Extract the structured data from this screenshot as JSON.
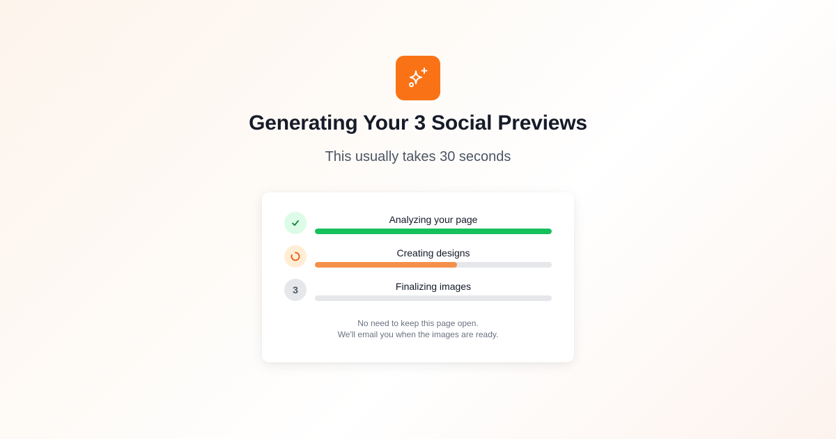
{
  "header": {
    "icon": "sparkles-icon",
    "accent_color": "#f97316",
    "title": "Generating Your 3 Social Previews",
    "subtitle": "This usually takes 30 seconds"
  },
  "steps": [
    {
      "label": "Analyzing your page",
      "status": "complete",
      "badge": "✓",
      "progress": 1.0,
      "color": "#16c05a"
    },
    {
      "label": "Creating designs",
      "status": "in-progress",
      "badge": "",
      "progress": 0.6,
      "color": "#f5904a"
    },
    {
      "label": "Finalizing images",
      "status": "pending",
      "badge": "3",
      "progress": 0.0,
      "color": "#e5e7eb"
    }
  ],
  "note": {
    "line1": "No need to keep this page open.",
    "line2": "We'll email you when the images are ready."
  }
}
